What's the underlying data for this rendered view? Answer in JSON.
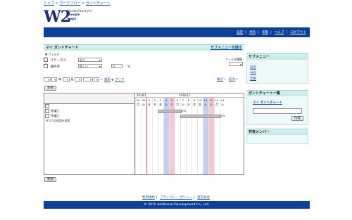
{
  "breadcrumb": [
    "トップ",
    "ワークフロー",
    "ガントチャート"
  ],
  "breadcrumb_sep": ">",
  "logo": {
    "mark": "W2",
    "line1": "GanttChart for",
    "line2": "Google",
    "line3": "Apps"
  },
  "top_nav": [
    "設定",
    "共有",
    "印刷",
    "ヘルプ",
    "ログアウト"
  ],
  "main": {
    "title": "マイ ガントチャート",
    "submenu_link": "サブメニューを隠す",
    "filter_label": "▼ フィルタ",
    "status_label": "ステータス",
    "status_value": "全て",
    "progress_label": "進捗率",
    "progress_op": "等しい",
    "progress_value": "0",
    "percent": "%",
    "filter_type_label": "フィルタ種類",
    "date_from_placeholder": "----",
    "year_suffix": "年",
    "month_suffix": "月",
    "apply_label": "適用",
    "clear_label": "クリア",
    "zoom_out": "縮小",
    "zoom_in": "拡大",
    "new_button": "新規",
    "new_button_bottom": "新規"
  },
  "gantt": {
    "month_left": "2016/1",
    "month_right": "2016/12",
    "days": [
      "29",
      "30",
      "1",
      "2",
      "3",
      "4",
      "5",
      "6",
      "7",
      "8",
      "9",
      "10",
      "11",
      "12",
      "13",
      "14"
    ],
    "weekdays": [
      "月",
      "火",
      "水",
      "木",
      "金",
      "土",
      "日",
      "月",
      "火",
      "水",
      "木",
      "金",
      "土",
      "日",
      "月",
      "火"
    ],
    "weekend_sat": [
      5,
      12
    ],
    "weekend_sun": [
      6,
      13
    ],
    "tasks": [
      {
        "name": "作業1",
        "start": 4,
        "end": 8,
        "progress": "0%"
      },
      {
        "name": "作業2",
        "start": 8,
        "end": 15,
        "progress": "0%"
      }
    ],
    "add_task": "タスクの追加を追加"
  },
  "sidebar": {
    "submenu_title": "サブメニュー",
    "submenu_items": [
      "設定",
      "共有",
      "印刷"
    ],
    "gantt_list_title": "ガントチャート一覧",
    "my_gantt_link": "マイ ガントチャート",
    "create_button": "作成",
    "members_title": "共有メンバー"
  },
  "footer": {
    "links": [
      "利用規約",
      "プライバシー ポリシー",
      "運営会社"
    ],
    "copyright": "© 2015 Additional Development Co., Ltd."
  },
  "colors": {
    "brand_blue": "#0b3f9e",
    "section_teal": "#bfe9e7",
    "saturday": "#c9cdf5",
    "sunday": "#f5c8d3"
  }
}
